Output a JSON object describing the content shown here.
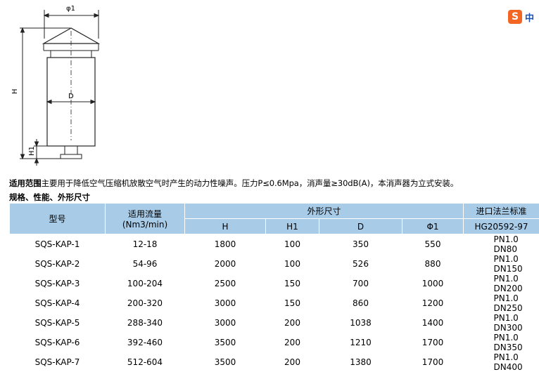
{
  "drawing": {
    "labels": {
      "phi1": "φ1",
      "D": "D",
      "H": "H",
      "H1": "H1"
    }
  },
  "ime": {
    "icon": "S",
    "text": "中"
  },
  "description": {
    "lead": "适用范围",
    "body": "主要用于降低空气压缩机放散空气时产生的动力性噪声。压力P≤0.6Mpa，消声量≥30dB(A)，本消声器为立式安装。"
  },
  "spec_heading": "规格、性能、外形尺寸",
  "table": {
    "head": {
      "model": "型号",
      "flow": "适用流量(Nm3/min)",
      "dims": "外形尺寸",
      "flange": "进口法兰标准",
      "H": "H",
      "H1": "H1",
      "D": "D",
      "phi1": "Φ1",
      "flange_std": "HG20592-97"
    },
    "rows": [
      [
        "SQS-KAP-1",
        "12-18",
        "1800",
        "100",
        "350",
        "550",
        "PN1.0 DN80"
      ],
      [
        "SQS-KAP-2",
        "54-96",
        "2000",
        "100",
        "526",
        "880",
        "PN1.0 DN150"
      ],
      [
        "SQS-KAP-3",
        "100-204",
        "2500",
        "150",
        "700",
        "1000",
        "PN1.0 DN200"
      ],
      [
        "SQS-KAP-4",
        "200-320",
        "3000",
        "150",
        "860",
        "1200",
        "PN1.0 DN250"
      ],
      [
        "SQS-KAP-5",
        "288-340",
        "3000",
        "200",
        "1038",
        "1400",
        "PN1.0 DN300"
      ],
      [
        "SQS-KAP-6",
        "392-460",
        "3500",
        "200",
        "1210",
        "1700",
        "PN1.0 DN350"
      ],
      [
        "SQS-KAP-7",
        "512-604",
        "3500",
        "200",
        "1380",
        "1700",
        "PN1.0 DN400"
      ]
    ]
  }
}
